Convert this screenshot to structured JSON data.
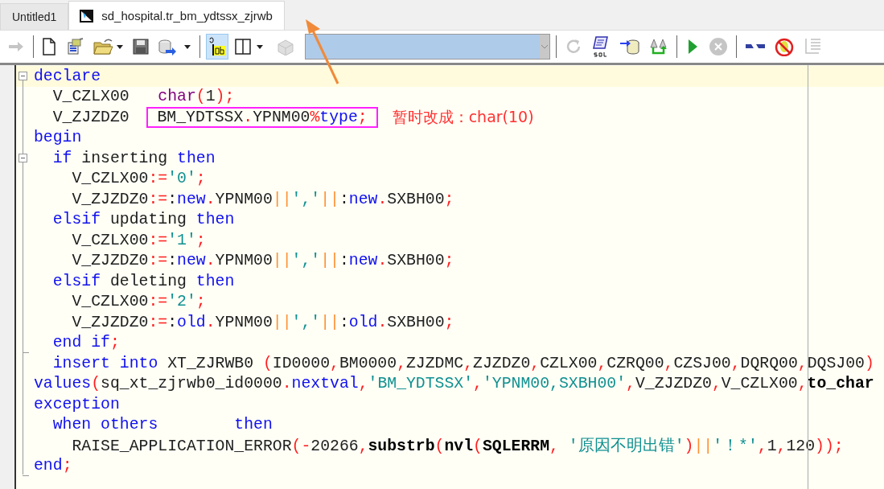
{
  "tabs": [
    {
      "label": "Untitled1",
      "selected": false
    },
    {
      "label": "sd_hospital.tr_bm_ydtssx_zjrwb",
      "selected": true
    }
  ],
  "toolbar": [
    {
      "disabled": true,
      "pressed": false
    },
    {
      "disabled": false,
      "pressed": false
    },
    {
      "disabled": false,
      "pressed": false
    },
    {
      "disabled": false,
      "pressed": false
    },
    {
      "disabled": false,
      "pressed": false
    },
    {
      "disabled": false,
      "pressed": false
    },
    {
      "disabled": false,
      "pressed": true
    },
    {
      "disabled": false,
      "pressed": false
    },
    {
      "disabled": true,
      "pressed": false
    },
    {
      "disabled": true,
      "pressed": false
    },
    {
      "disabled": false,
      "pressed": false
    },
    {
      "disabled": false,
      "pressed": false
    },
    {
      "disabled": false,
      "pressed": false
    },
    {
      "disabled": false,
      "pressed": false
    },
    {
      "disabled": true,
      "pressed": false
    },
    {
      "disabled": false,
      "pressed": false
    },
    {
      "disabled": false,
      "pressed": false
    },
    {
      "disabled": true,
      "pressed": false
    }
  ],
  "editor": {
    "lines": [
      {
        "current": true,
        "collapsible": true,
        "fold_end": false,
        "segments": [
          {
            "kind": "kw",
            "text": "declare"
          }
        ]
      },
      {
        "current": false,
        "collapsible": false,
        "fold_end": false,
        "segments": [
          {
            "kind": "id",
            "text": "  V_CZLX00   "
          },
          {
            "kind": "type",
            "text": "char"
          },
          {
            "kind": "op",
            "text": "("
          },
          {
            "kind": "id",
            "text": "1"
          },
          {
            "kind": "op",
            "text": ");"
          }
        ]
      },
      {
        "current": false,
        "collapsible": false,
        "fold_end": false,
        "segments": [
          {
            "kind": "id",
            "text": "  V_ZJZDZ0  "
          }
        ],
        "boxed": [
          {
            "kind": "id",
            "text": "BM_YDTSSX"
          },
          {
            "kind": "op",
            "text": "."
          },
          {
            "kind": "id",
            "text": "YPNM00"
          },
          {
            "kind": "op",
            "text": "%"
          },
          {
            "kind": "kw",
            "text": "type"
          },
          {
            "kind": "op",
            "text": ";"
          }
        ],
        "note": "暂时改成：char(10)"
      },
      {
        "current": false,
        "collapsible": false,
        "fold_end": false,
        "segments": [
          {
            "kind": "kw",
            "text": "begin"
          }
        ]
      },
      {
        "current": false,
        "collapsible": true,
        "fold_end": false,
        "segments": [
          {
            "kind": "kw",
            "text": "  if"
          },
          {
            "kind": "id",
            "text": " inserting "
          },
          {
            "kind": "kw",
            "text": "then"
          }
        ]
      },
      {
        "current": false,
        "collapsible": false,
        "fold_end": false,
        "segments": [
          {
            "kind": "id",
            "text": "    V_CZLX00"
          },
          {
            "kind": "op",
            "text": ":="
          },
          {
            "kind": "str",
            "text": "'0'"
          },
          {
            "kind": "op",
            "text": ";"
          }
        ]
      },
      {
        "current": false,
        "collapsible": false,
        "fold_end": false,
        "segments": [
          {
            "kind": "id",
            "text": "    V_ZJZDZ0"
          },
          {
            "kind": "op",
            "text": ":="
          },
          {
            "kind": "id",
            "text": ":"
          },
          {
            "kind": "kw",
            "text": "new"
          },
          {
            "kind": "op",
            "text": "."
          },
          {
            "kind": "id",
            "text": "YPNM00"
          },
          {
            "kind": "cat",
            "text": "||"
          },
          {
            "kind": "str",
            "text": "','"
          },
          {
            "kind": "cat",
            "text": "||"
          },
          {
            "kind": "id",
            "text": ":"
          },
          {
            "kind": "kw",
            "text": "new"
          },
          {
            "kind": "op",
            "text": "."
          },
          {
            "kind": "id",
            "text": "SXBH00"
          },
          {
            "kind": "op",
            "text": ";"
          }
        ]
      },
      {
        "current": false,
        "collapsible": false,
        "fold_end": false,
        "segments": [
          {
            "kind": "kw",
            "text": "  elsif"
          },
          {
            "kind": "id",
            "text": " updating "
          },
          {
            "kind": "kw",
            "text": "then"
          }
        ]
      },
      {
        "current": false,
        "collapsible": false,
        "fold_end": false,
        "segments": [
          {
            "kind": "id",
            "text": "    V_CZLX00"
          },
          {
            "kind": "op",
            "text": ":="
          },
          {
            "kind": "str",
            "text": "'1'"
          },
          {
            "kind": "op",
            "text": ";"
          }
        ]
      },
      {
        "current": false,
        "collapsible": false,
        "fold_end": false,
        "segments": [
          {
            "kind": "id",
            "text": "    V_ZJZDZ0"
          },
          {
            "kind": "op",
            "text": ":="
          },
          {
            "kind": "id",
            "text": ":"
          },
          {
            "kind": "kw",
            "text": "new"
          },
          {
            "kind": "op",
            "text": "."
          },
          {
            "kind": "id",
            "text": "YPNM00"
          },
          {
            "kind": "cat",
            "text": "||"
          },
          {
            "kind": "str",
            "text": "','"
          },
          {
            "kind": "cat",
            "text": "||"
          },
          {
            "kind": "id",
            "text": ":"
          },
          {
            "kind": "kw",
            "text": "new"
          },
          {
            "kind": "op",
            "text": "."
          },
          {
            "kind": "id",
            "text": "SXBH00"
          },
          {
            "kind": "op",
            "text": ";"
          }
        ]
      },
      {
        "current": false,
        "collapsible": false,
        "fold_end": false,
        "segments": [
          {
            "kind": "kw",
            "text": "  elsif"
          },
          {
            "kind": "id",
            "text": " deleting "
          },
          {
            "kind": "kw",
            "text": "then"
          }
        ]
      },
      {
        "current": false,
        "collapsible": false,
        "fold_end": false,
        "segments": [
          {
            "kind": "id",
            "text": "    V_CZLX00"
          },
          {
            "kind": "op",
            "text": ":="
          },
          {
            "kind": "str",
            "text": "'2'"
          },
          {
            "kind": "op",
            "text": ";"
          }
        ]
      },
      {
        "current": false,
        "collapsible": false,
        "fold_end": false,
        "segments": [
          {
            "kind": "id",
            "text": "    V_ZJZDZ0"
          },
          {
            "kind": "op",
            "text": ":="
          },
          {
            "kind": "id",
            "text": ":"
          },
          {
            "kind": "kw",
            "text": "old"
          },
          {
            "kind": "op",
            "text": "."
          },
          {
            "kind": "id",
            "text": "YPNM00"
          },
          {
            "kind": "cat",
            "text": "||"
          },
          {
            "kind": "str",
            "text": "','"
          },
          {
            "kind": "cat",
            "text": "||"
          },
          {
            "kind": "id",
            "text": ":"
          },
          {
            "kind": "kw",
            "text": "old"
          },
          {
            "kind": "op",
            "text": "."
          },
          {
            "kind": "id",
            "text": "SXBH00"
          },
          {
            "kind": "op",
            "text": ";"
          }
        ]
      },
      {
        "current": false,
        "collapsible": false,
        "fold_end": true,
        "segments": [
          {
            "kind": "kw",
            "text": "  end if"
          },
          {
            "kind": "op",
            "text": ";"
          }
        ]
      },
      {
        "current": false,
        "collapsible": false,
        "fold_end": false,
        "segments": [
          {
            "kind": "kw",
            "text": "  insert into"
          },
          {
            "kind": "id",
            "text": " XT_ZJRWB0 "
          },
          {
            "kind": "op",
            "text": "("
          },
          {
            "kind": "id",
            "text": "ID0000"
          },
          {
            "kind": "op",
            "text": ","
          },
          {
            "kind": "id",
            "text": "BM0000"
          },
          {
            "kind": "op",
            "text": ","
          },
          {
            "kind": "id",
            "text": "ZJZDMC"
          },
          {
            "kind": "op",
            "text": ","
          },
          {
            "kind": "id",
            "text": "ZJZDZ0"
          },
          {
            "kind": "op",
            "text": ","
          },
          {
            "kind": "id",
            "text": "CZLX00"
          },
          {
            "kind": "op",
            "text": ","
          },
          {
            "kind": "id",
            "text": "CZRQ00"
          },
          {
            "kind": "op",
            "text": ","
          },
          {
            "kind": "id",
            "text": "CZSJ00"
          },
          {
            "kind": "op",
            "text": ","
          },
          {
            "kind": "id",
            "text": "DQRQ00"
          },
          {
            "kind": "op",
            "text": ","
          },
          {
            "kind": "id",
            "text": "DQSJ00"
          },
          {
            "kind": "op",
            "text": ")"
          }
        ]
      },
      {
        "current": false,
        "collapsible": false,
        "fold_end": false,
        "segments": [
          {
            "kind": "kw",
            "text": "values"
          },
          {
            "kind": "op",
            "text": "("
          },
          {
            "kind": "id",
            "text": "sq_xt_zjrwb0_id0000"
          },
          {
            "kind": "op",
            "text": "."
          },
          {
            "kind": "kw",
            "text": "nextval"
          },
          {
            "kind": "op",
            "text": ","
          },
          {
            "kind": "str",
            "text": "'BM_YDTSSX'"
          },
          {
            "kind": "op",
            "text": ","
          },
          {
            "kind": "str",
            "text": "'YPNM00,SXBH00'"
          },
          {
            "kind": "op",
            "text": ","
          },
          {
            "kind": "id",
            "text": "V_ZJZDZ0"
          },
          {
            "kind": "op",
            "text": ","
          },
          {
            "kind": "id",
            "text": "V_CZLX00"
          },
          {
            "kind": "op",
            "text": ","
          },
          {
            "kind": "fn",
            "text": "to_char"
          }
        ]
      },
      {
        "current": false,
        "collapsible": false,
        "fold_end": false,
        "segments": [
          {
            "kind": "kw",
            "text": "exception"
          }
        ]
      },
      {
        "current": false,
        "collapsible": false,
        "fold_end": false,
        "segments": [
          {
            "kind": "kw",
            "text": "  when others        then"
          }
        ]
      },
      {
        "current": false,
        "collapsible": false,
        "fold_end": false,
        "segments": [
          {
            "kind": "id",
            "text": "    RAISE_APPLICATION_ERROR"
          },
          {
            "kind": "op",
            "text": "(-"
          },
          {
            "kind": "id",
            "text": "20266"
          },
          {
            "kind": "op",
            "text": ","
          },
          {
            "kind": "fn",
            "text": "substrb"
          },
          {
            "kind": "op",
            "text": "("
          },
          {
            "kind": "fn",
            "text": "nvl"
          },
          {
            "kind": "op",
            "text": "("
          },
          {
            "kind": "fn",
            "text": "SQLERRM"
          },
          {
            "kind": "op",
            "text": ", "
          },
          {
            "kind": "str",
            "text": "'原因不明出错'"
          },
          {
            "kind": "op",
            "text": ")"
          },
          {
            "kind": "cat",
            "text": "||"
          },
          {
            "kind": "str",
            "text": "'！*'"
          },
          {
            "kind": "op",
            "text": ","
          },
          {
            "kind": "id",
            "text": "1"
          },
          {
            "kind": "op",
            "text": ","
          },
          {
            "kind": "id",
            "text": "120"
          },
          {
            "kind": "op",
            "text": "));"
          }
        ]
      },
      {
        "current": false,
        "collapsible": false,
        "fold_end": true,
        "segments": [
          {
            "kind": "kw",
            "text": "end"
          },
          {
            "kind": "op",
            "text": ";"
          }
        ]
      }
    ]
  }
}
